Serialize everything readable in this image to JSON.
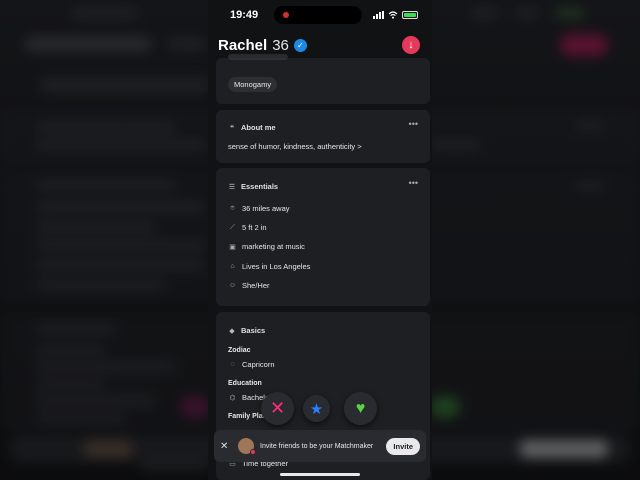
{
  "status_bar": {
    "time": "19:49"
  },
  "profile": {
    "name": "Rachel",
    "age": "36"
  },
  "relationship_type": {
    "chip": "Monogamy"
  },
  "about": {
    "title": "About me",
    "text": "sense of humor, kindness, authenticity >"
  },
  "essentials": {
    "title": "Essentials",
    "rows": [
      {
        "icon": "location-pin-icon",
        "text": "36 miles away"
      },
      {
        "icon": "ruler-icon",
        "text": "5 ft 2 in"
      },
      {
        "icon": "briefcase-icon",
        "text": "marketing at music"
      },
      {
        "icon": "home-icon",
        "text": "Lives in Los Angeles"
      },
      {
        "icon": "person-icon",
        "text": "She/Her"
      }
    ]
  },
  "basics": {
    "title": "Basics",
    "zodiac_label": "Zodiac",
    "zodiac_value": "Capricorn",
    "education_label": "Education",
    "education_value": "Bachelo",
    "family_label": "Family Plans",
    "family_value": "Time together"
  },
  "actions": [
    "pass-x-icon",
    "super-like-star-icon",
    "like-heart-icon"
  ],
  "invite": {
    "text": "Invite friends to be your Matchmaker",
    "button": "Invite"
  },
  "colors": {
    "accent_pink": "#e5395b",
    "verified_blue": "#1e88e5",
    "like_green": "#5ad542"
  }
}
